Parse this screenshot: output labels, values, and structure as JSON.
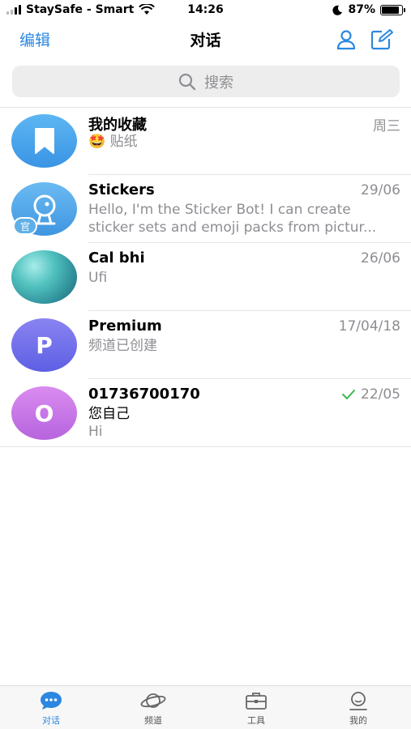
{
  "status_bar": {
    "carrier": "StaySafe - Smart",
    "time": "14:26",
    "battery": "87%",
    "battery_level": 0.87
  },
  "nav": {
    "edit_label": "编辑",
    "title": "对话",
    "contacts_icon": "person-icon",
    "compose_icon": "compose-icon"
  },
  "search": {
    "placeholder": "搜索"
  },
  "chats": [
    {
      "name": "我的收藏",
      "message": "贴纸",
      "emoji": "🤩",
      "date": "周三",
      "avatar_color": "#4aa5ec",
      "avatar_icon": "bookmark-icon"
    },
    {
      "name": "Stickers",
      "message": "Hello, I'm the Sticker Bot! I can create sticker sets and emoji packs from pictur...",
      "date": "29/06",
      "avatar_color": "#56a9e8",
      "badge": "官",
      "avatar_icon": "bot-icon"
    },
    {
      "name": "Cal bhi",
      "message": "Ufi",
      "date": "26/06",
      "avatar_color": "#5bbfbd"
    },
    {
      "name": "Premium",
      "message": "频道已创建",
      "date": "17/04/18",
      "avatar_letter": "P",
      "avatar_color": "#7d74ec"
    },
    {
      "name": "01736700170",
      "message": "您自己",
      "message2": "Hi",
      "date": "22/05",
      "avatar_letter": "O",
      "avatar_color": "#c57be6",
      "read_check": true
    }
  ],
  "tabs": [
    {
      "label": "对话",
      "icon": "chat-bubble-icon",
      "active": true
    },
    {
      "label": "频道",
      "icon": "planet-icon",
      "active": false
    },
    {
      "label": "工具",
      "icon": "toolbox-icon",
      "active": false
    },
    {
      "label": "我的",
      "icon": "profile-icon",
      "active": false
    }
  ],
  "colors": {
    "accent": "#2b87e0",
    "secondary_text": "#8e8e93",
    "check": "#3cb950"
  }
}
